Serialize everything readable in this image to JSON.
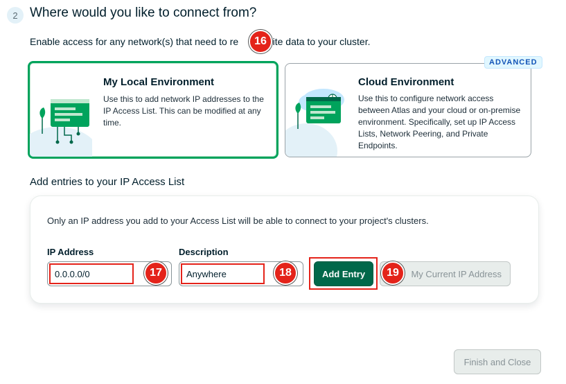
{
  "step": {
    "number": "2",
    "title": "Where would you like to connect from?"
  },
  "intro": {
    "text_before": "Enable access for any network(s) that need to re",
    "text_after": "d write data to your cluster."
  },
  "cards": {
    "local": {
      "title": "My Local Environment",
      "description": "Use this to add network IP addresses to the IP Access List. This can be modified at any time."
    },
    "cloud": {
      "badge": "ADVANCED",
      "title": "Cloud Environment",
      "description": "Use this to configure network access between Atlas and your cloud or on-premise environment. Specifically, set up IP Access Lists, Network Peering, and Private Endpoints."
    }
  },
  "access_list": {
    "section_title": "Add entries to your IP Access List",
    "note": "Only an IP address you add to your Access List will be able to connect to your project's clusters.",
    "ip_label": "IP Address",
    "ip_value": "0.0.0.0/0",
    "desc_label": "Description",
    "desc_value": "Anywhere",
    "add_button": "Add Entry",
    "my_ip_button": "My Current IP Address"
  },
  "footer": {
    "finish_button": "Finish and Close"
  },
  "markers": [
    "16",
    "17",
    "18",
    "19"
  ],
  "colors": {
    "accent_green": "#00a35c",
    "button_green": "#00684a",
    "marker_red": "#e4231a",
    "badge_blue": "#1254b7"
  }
}
